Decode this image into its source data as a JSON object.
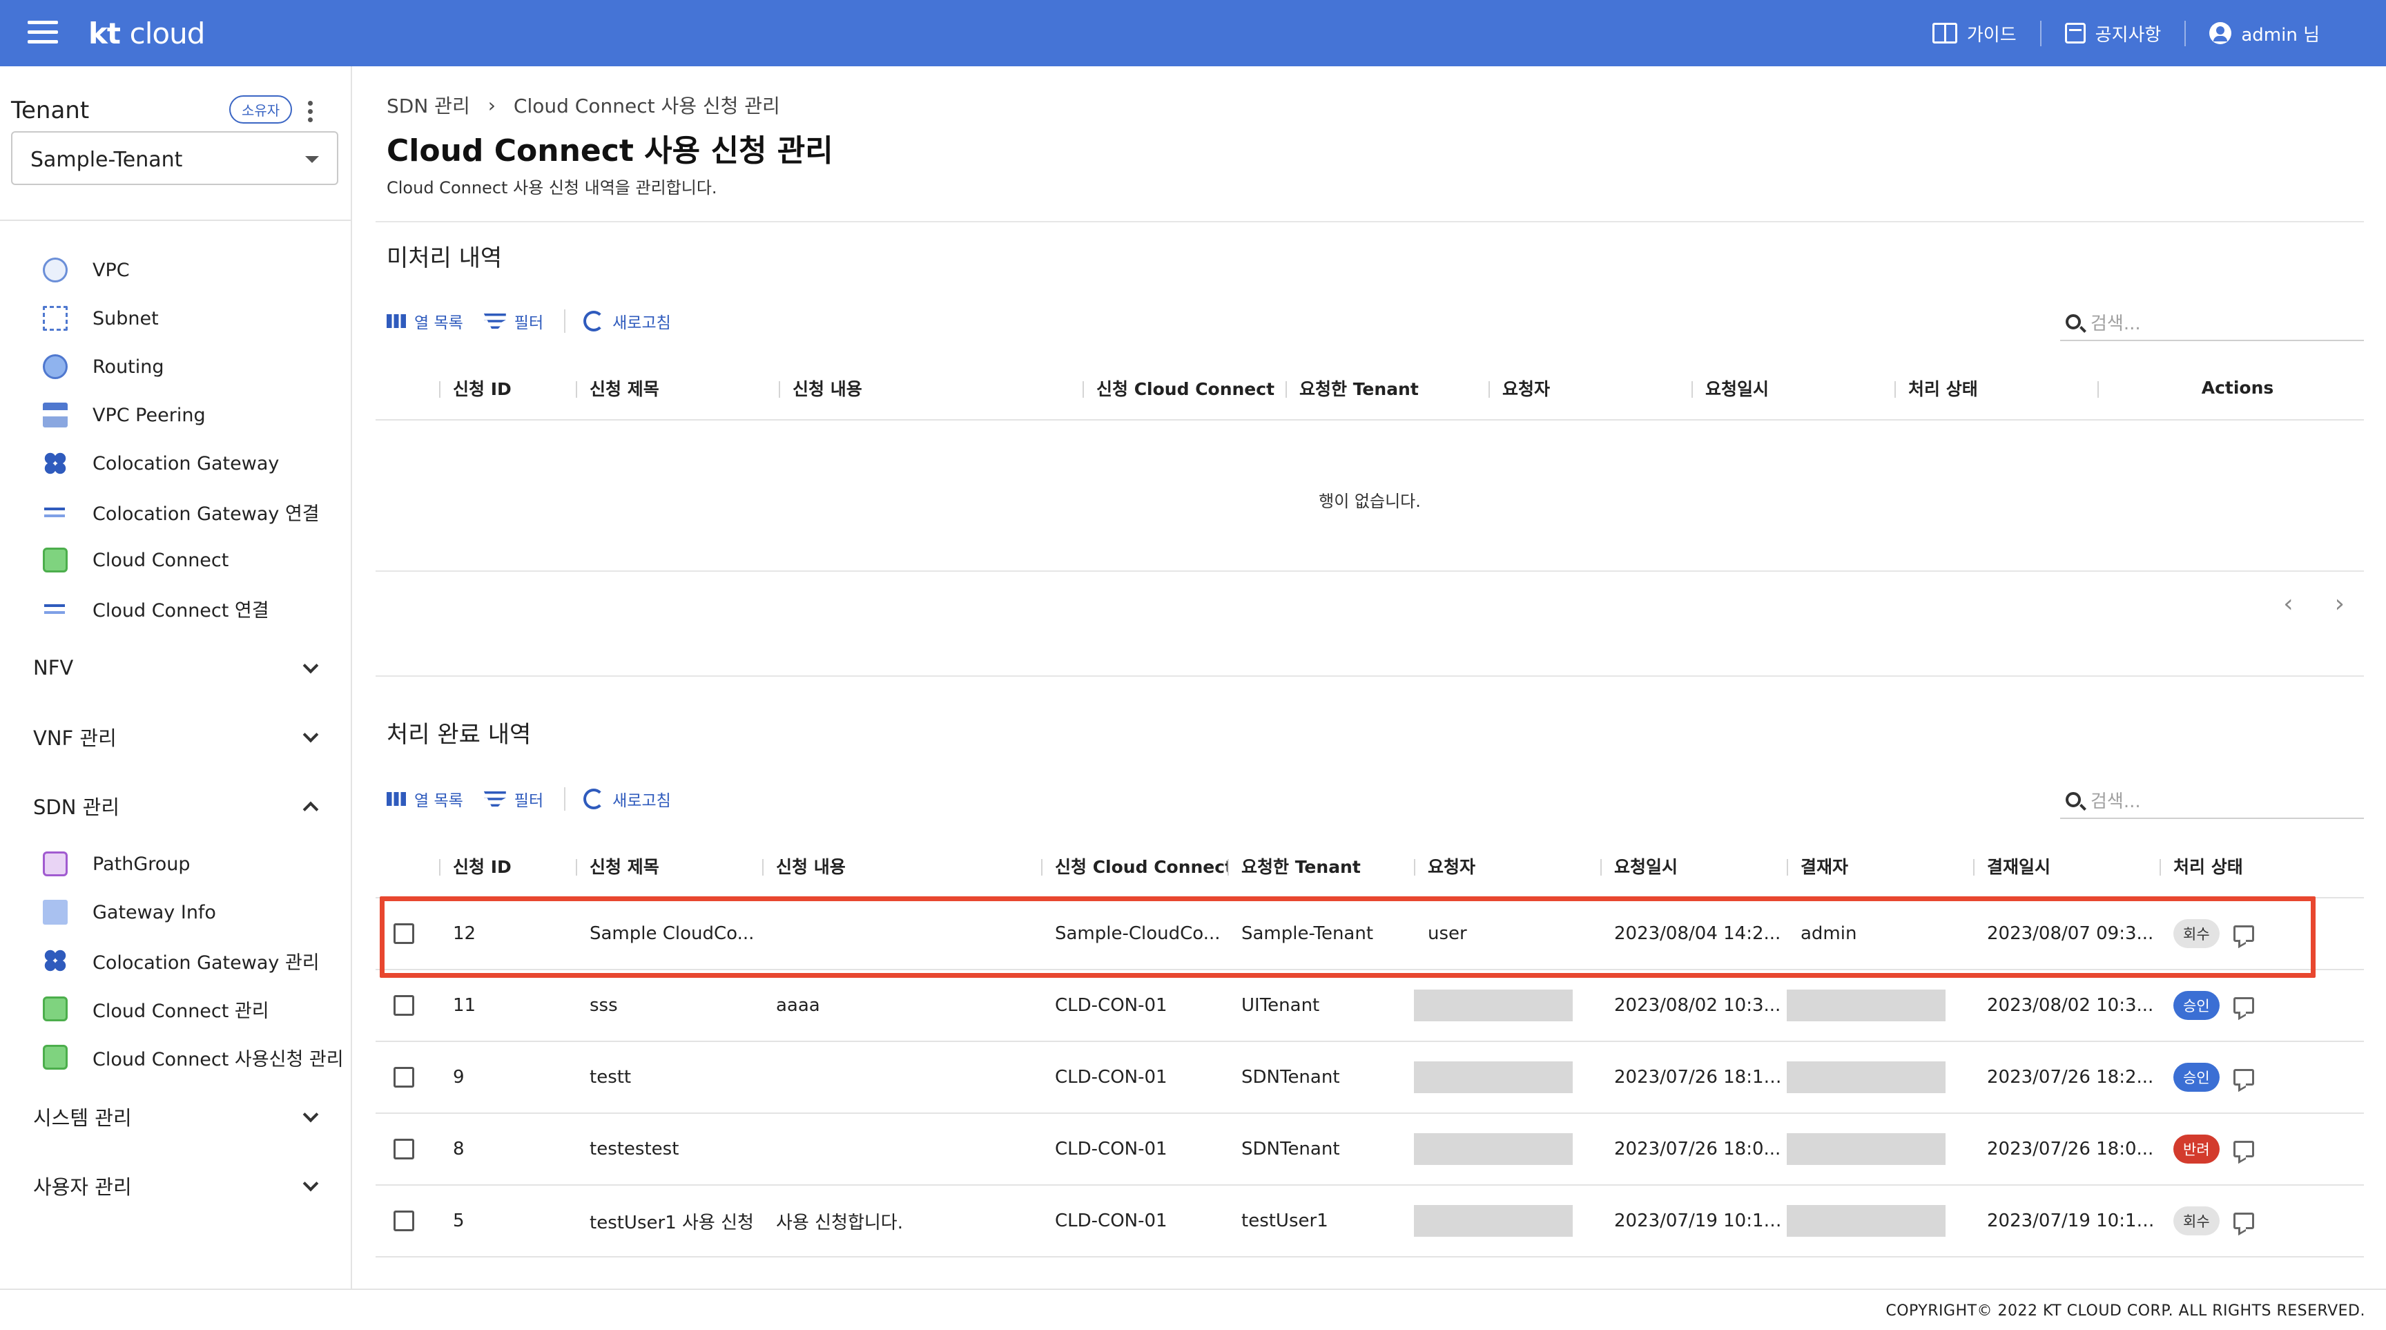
{
  "header": {
    "logo_kt": "kt",
    "logo_cloud": "cloud",
    "guide": "가이드",
    "notice": "공지사항",
    "user": "admin 님"
  },
  "sidebar": {
    "tenant_label": "Tenant",
    "owner_chip": "소유자",
    "tenant_value": "Sample-Tenant",
    "items": [
      {
        "label": "VPC",
        "icon": "vpc-icon"
      },
      {
        "label": "Subnet",
        "icon": "subnet-icon"
      },
      {
        "label": "Routing",
        "icon": "routing-icon"
      },
      {
        "label": "VPC Peering",
        "icon": "vpc-peering-icon"
      },
      {
        "label": "Colocation Gateway",
        "icon": "colocation-gateway-icon"
      },
      {
        "label": "Colocation Gateway 연결",
        "icon": "connection-arrow-icon"
      },
      {
        "label": "Cloud Connect",
        "icon": "cloud-connect-icon"
      },
      {
        "label": "Cloud Connect 연결",
        "icon": "connection-arrow-icon"
      }
    ],
    "groups": {
      "nfv": "NFV",
      "vnf": "VNF 관리",
      "sdn": "SDN 관리",
      "system": "시스템 관리",
      "users": "사용자 관리"
    },
    "sdn_items": [
      {
        "label": "PathGroup",
        "icon": "pathgroup-icon"
      },
      {
        "label": "Gateway Info",
        "icon": "document-icon"
      },
      {
        "label": "Colocation Gateway 관리",
        "icon": "colocation-gateway-icon"
      },
      {
        "label": "Cloud Connect 관리",
        "icon": "cloud-connect-icon"
      },
      {
        "label": "Cloud Connect 사용신청 관리",
        "icon": "cloud-connect-icon"
      }
    ]
  },
  "page": {
    "breadcrumb_parent": "SDN 관리",
    "breadcrumb_sep": "›",
    "breadcrumb_current": "Cloud Connect 사용 신청 관리",
    "title": "Cloud Connect 사용 신청 관리",
    "description": "Cloud Connect 사용 신청 내역을 관리합니다."
  },
  "toolbar": {
    "columns": "열 목록",
    "filter": "필터",
    "refresh": "새로고침",
    "search_placeholder": "검색..."
  },
  "pending": {
    "title": "미처리 내역",
    "columns": [
      "신청 ID",
      "신청 제목",
      "신청 내용",
      "신청 Cloud Connect",
      "요청한 Tenant",
      "요청자",
      "요청일시",
      "처리 상태",
      "Actions"
    ],
    "empty": "행이 없습니다.",
    "prev": "‹",
    "next": "›"
  },
  "done": {
    "title": "처리 완료 내역",
    "columns": [
      "신청 ID",
      "신청 제목",
      "신청 내용",
      "신청 Cloud Connect",
      "요청한 Tenant",
      "요청자",
      "요청일시",
      "결재자",
      "결재일시",
      "처리 상태"
    ],
    "rows": [
      {
        "id": "12",
        "subject": "Sample CloudCo...",
        "content": "",
        "cc": "Sample-CloudCo...",
        "tenant": "Sample-Tenant",
        "requester": "user",
        "req_at": "2023/08/04 14:2...",
        "approver": "admin",
        "appr_at": "2023/08/07 09:3...",
        "status": "회수",
        "status_color": "#e3e3e3"
      },
      {
        "id": "11",
        "subject": "sss",
        "content": "aaaa",
        "cc": "CLD-CON-01",
        "tenant": "UITenant",
        "requester": "",
        "req_at": "2023/08/02 10:3...",
        "approver": "",
        "appr_at": "2023/08/02 10:3...",
        "status": "승인",
        "status_color": "#3b6fd4"
      },
      {
        "id": "9",
        "subject": "testt",
        "content": "",
        "cc": "CLD-CON-01",
        "tenant": "SDNTenant",
        "requester": "",
        "req_at": "2023/07/26 18:11...",
        "approver": "",
        "appr_at": "2023/07/26 18:2...",
        "status": "승인",
        "status_color": "#3b6fd4"
      },
      {
        "id": "8",
        "subject": "testestest",
        "content": "",
        "cc": "CLD-CON-01",
        "tenant": "SDNTenant",
        "requester": "",
        "req_at": "2023/07/26 18:0...",
        "approver": "",
        "appr_at": "2023/07/26 18:0...",
        "status": "반려",
        "status_color": "#d33b2d"
      },
      {
        "id": "5",
        "subject": "testUser1 사용 신청",
        "content": "사용 신청합니다.",
        "cc": "CLD-CON-01",
        "tenant": "testUser1",
        "requester": "",
        "req_at": "2023/07/19 10:11...",
        "approver": "",
        "appr_at": "2023/07/19 10:12...",
        "status": "회수",
        "status_color": "#e3e3e3"
      }
    ]
  },
  "footer": "COPYRIGHT© 2022 KT CLOUD CORP. ALL RIGHTS RESERVED."
}
